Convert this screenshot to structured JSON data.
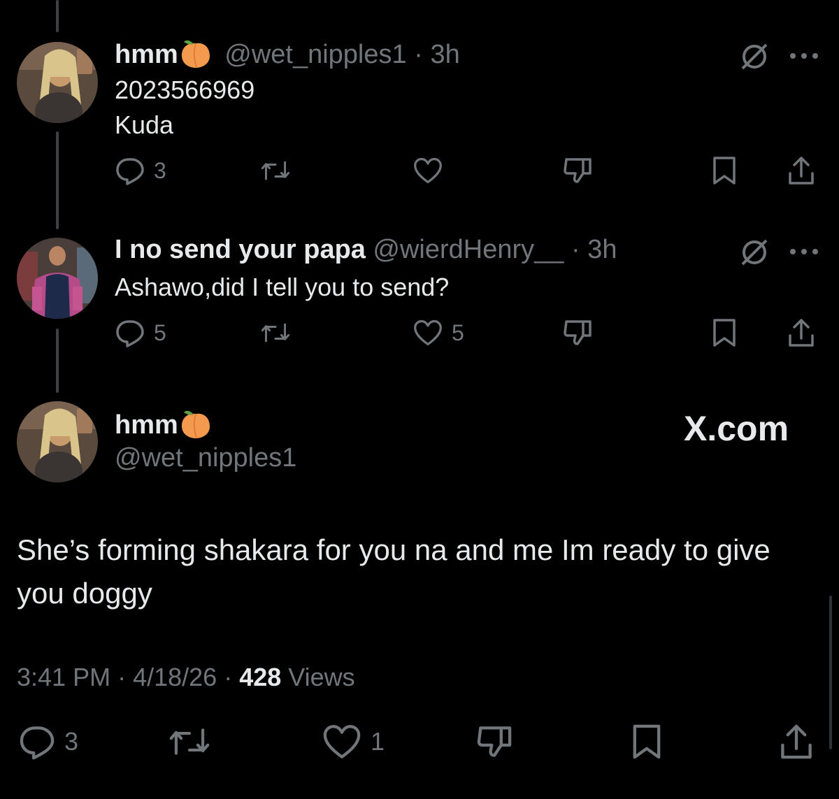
{
  "tweet1": {
    "name": "hmm",
    "handle": "@wet_nipples1",
    "time": "3h",
    "lines": [
      "2023566969",
      "Kuda"
    ],
    "reply_count": "3",
    "retweet_count": "",
    "like_count": ""
  },
  "tweet2": {
    "name": "I no send your papa",
    "handle": "@wierdHenry__",
    "time": "3h",
    "text": "Ashawo,did I tell you to send?",
    "reply_count": "5",
    "retweet_count": "",
    "like_count": "5"
  },
  "main": {
    "name": "hmm",
    "handle": "@wet_nipples1",
    "watermark": "X.com",
    "text_line1": "She’s forming shakara for you na and me Im ready to give",
    "text_line2": "you doggy",
    "time": "3:41 PM",
    "date": "4/18/26",
    "views_count": "428",
    "views_label": "Views",
    "reply_count": "3",
    "retweet_count": "",
    "like_count": "1"
  },
  "icons": {
    "reply": "reply-icon",
    "retweet": "retweet-icon",
    "like": "like-icon",
    "dislike": "dislike-icon",
    "bookmark": "bookmark-icon",
    "share": "share-icon",
    "mute": "mute-icon",
    "more": "more-icon",
    "peach": "peach-emoji"
  },
  "colors": {
    "background": "#000000",
    "text": "#e7e9ea",
    "secondary": "#71767b",
    "thread_line": "#3e4144"
  }
}
